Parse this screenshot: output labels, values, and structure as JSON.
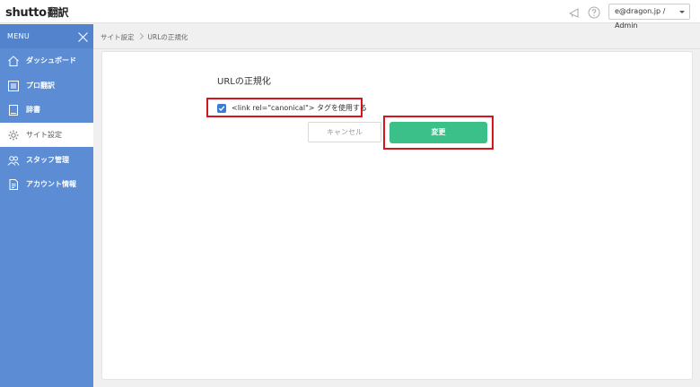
{
  "app": {
    "logo_text": "shutto",
    "logo_suffix": "翻訳"
  },
  "header": {
    "user_label": "e@dragon.jp / Admin",
    "icons": [
      "megaphone-icon",
      "help-icon"
    ]
  },
  "sidebar": {
    "menu_label": "MENU",
    "items": [
      {
        "label": "ダッシュボード",
        "icon": "home-icon"
      },
      {
        "label": "プロ翻訳",
        "icon": "grid-icon"
      },
      {
        "label": "辞書",
        "icon": "book-icon"
      },
      {
        "label": "サイト設定",
        "icon": "gear-icon",
        "active": true
      },
      {
        "label": "スタッフ管理",
        "icon": "staff-icon"
      },
      {
        "label": "アカウント情報",
        "icon": "document-icon"
      }
    ]
  },
  "breadcrumb": {
    "items": [
      "サイト設定",
      "URLの正規化"
    ]
  },
  "form": {
    "title": "URLの正規化",
    "checkbox_label": "<link rel=\"canonical\"> タグを使用する",
    "checkbox_checked": true,
    "cancel_label": "キャンセル",
    "submit_label": "変更"
  },
  "colors": {
    "sidebar": "#5b8cd4",
    "submit": "#3cc08a",
    "highlight": "#d7151e",
    "checkbox": "#3a7bd5"
  }
}
